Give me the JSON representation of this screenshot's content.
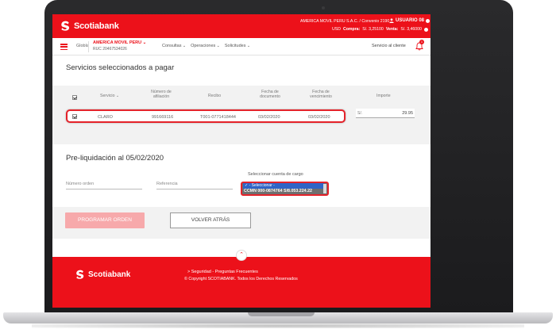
{
  "brand": {
    "name": "Scotiabank",
    "accent": "#ec111a",
    "highlight": "#e5222a"
  },
  "header": {
    "company_line": "AMERICA MOVIL PERU S.A.C. / Convenio 2190",
    "user_label": "USUARIO 08",
    "usd_label": "USD",
    "compra_label": "Compra:",
    "compra_value": "S/. 3,25100",
    "venta_label": "Venta:",
    "venta_value": "S/. 3,46000"
  },
  "nav": {
    "global": "Globla",
    "company": "AMERICA MOVIL PERU",
    "ruc": "RUC 20467534026",
    "menu": [
      "Consultas",
      "Operaciones",
      "Solicitudes"
    ],
    "support": "Servicio al cliente",
    "notifications": "1"
  },
  "services": {
    "title": "Servicios seleccionados a pagar",
    "columns": {
      "servicio": "Servicio",
      "afiliacion": "Número de afiliación",
      "recibo": "Recibo",
      "fecha_doc": "Fecha de documento",
      "fecha_venc": "Fecha de vencimiento",
      "importe": "Importe"
    },
    "row": {
      "servicio": "CLARO",
      "afiliacion": "991669116",
      "recibo": "T001-0771418444",
      "fecha_doc": "03/02/2020",
      "fecha_venc": "03/02/2020",
      "currency": "S/.",
      "importe": "29.95"
    }
  },
  "preliq": {
    "title": "Pre-liquidación al 05/02/2020",
    "numero_orden": "Número orden",
    "referencia": "Referencia",
    "cuenta_label": "Seleccionar cuenta de cargo",
    "option_default": "- Seleccionar -",
    "option_account": "CCMN 000-0874764 S/8.053.224.22"
  },
  "actions": {
    "programar": "PROGRAMAR ORDEN",
    "volver": "VOLVER ATRÁS"
  },
  "footer": {
    "links": "> Seguridad - Preguntas Frecuentes",
    "copyright": "© Copyright SCOTIABANK. Todos los Derechos Reservados"
  }
}
